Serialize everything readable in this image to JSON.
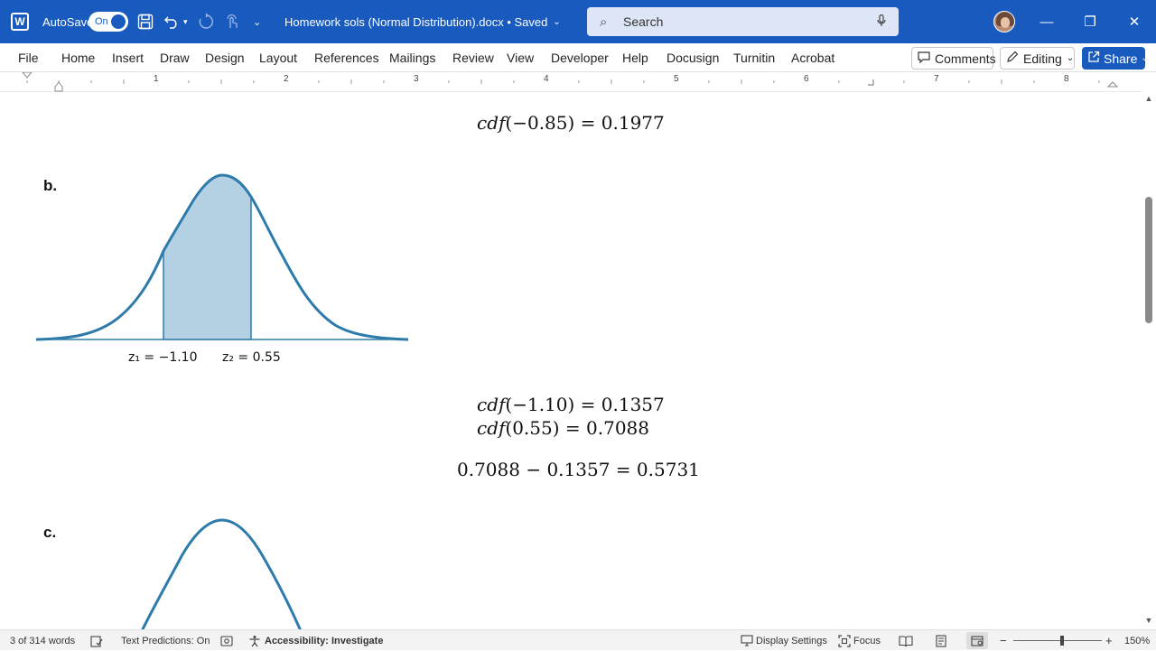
{
  "titlebar": {
    "autosave_label": "AutoSave",
    "autosave_state": "On",
    "doc_title": "Homework sols (Normal Distribution).docx • Saved",
    "search_placeholder": "Search",
    "window_minimize": "—",
    "window_restore": "❐",
    "window_close": "✕"
  },
  "ribbon": {
    "tabs": [
      "File",
      "Home",
      "Insert",
      "Draw",
      "Design",
      "Layout",
      "References",
      "Mailings",
      "Review",
      "View",
      "Developer",
      "Help",
      "Docusign",
      "Turnitin",
      "Acrobat"
    ],
    "comments_label": "Comments",
    "editing_label": "Editing",
    "share_label": "Share"
  },
  "ruler": {
    "numbers": [
      "1",
      "2",
      "3",
      "4",
      "5",
      "6",
      "7",
      "8"
    ]
  },
  "document": {
    "eq_prev": "𝑐𝑑𝑓(−0.85) = 0.1977",
    "part_b_label": "b.",
    "part_b_z1": "z₁ = −1.10",
    "part_b_z2": "z₂ = 0.55",
    "eq_b1": "𝑐𝑑𝑓(−1.10) = 0.1357",
    "eq_b2": "𝑐𝑑𝑓(0.55) = 0.7088",
    "eq_b3": "0.7088 − 0.1357 = 0.5731",
    "part_c_label": "c.",
    "curve_color": "#2e7bab",
    "fill_color": "#b3d1e3"
  },
  "status": {
    "words": "3 of 314 words",
    "text_predictions": "Text Predictions: On",
    "accessibility": "Accessibility: Investigate",
    "display_settings": "Display Settings",
    "focus": "Focus",
    "zoom": "150%"
  }
}
